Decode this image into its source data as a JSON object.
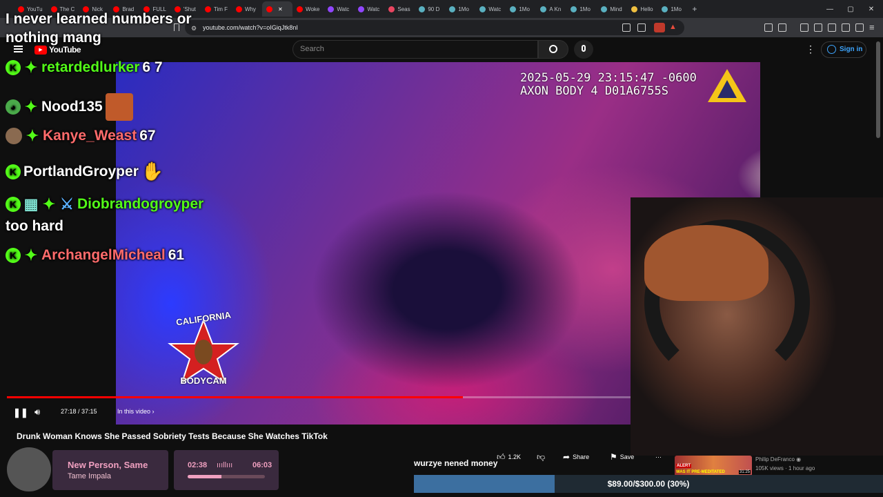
{
  "browser": {
    "tabs": [
      {
        "label": "YouTu",
        "color": "#ff0000"
      },
      {
        "label": "The C",
        "color": "#ff0000"
      },
      {
        "label": "Nick",
        "color": "#ff0000"
      },
      {
        "label": "Brad",
        "color": "#ff0000"
      },
      {
        "label": "FULL",
        "color": "#ff0000"
      },
      {
        "label": "'Shut",
        "color": "#ff0000"
      },
      {
        "label": "Tim F",
        "color": "#ff0000"
      },
      {
        "label": "Why",
        "color": "#ff0000"
      },
      {
        "label": "",
        "color": "#ff0000",
        "active": true
      },
      {
        "label": "Woke",
        "color": "#ff0000"
      },
      {
        "label": "Watc",
        "color": "#9146ff"
      },
      {
        "label": "Watc",
        "color": "#9146ff"
      },
      {
        "label": "Seas",
        "color": "#e94560"
      },
      {
        "label": "90 D",
        "color": "#5ab0c0"
      },
      {
        "label": "1Mo",
        "color": "#5ab0c0"
      },
      {
        "label": "Watc",
        "color": "#5ab0c0"
      },
      {
        "label": "1Mo",
        "color": "#5ab0c0"
      },
      {
        "label": "A Kn",
        "color": "#5ab0c0"
      },
      {
        "label": "1Mo",
        "color": "#5ab0c0"
      },
      {
        "label": "Mind",
        "color": "#5ab0c0"
      },
      {
        "label": "Hello",
        "color": "#f0c040"
      },
      {
        "label": "1Mo",
        "color": "#5ab0c0"
      }
    ],
    "new_tab": "+",
    "url": "youtube.com/watch?v=oIGiqJtk8nI"
  },
  "youtube": {
    "logo": "YouTube",
    "search_placeholder": "Search",
    "signin": "Sign in",
    "video_timestamp_line1": "2025-05-29 23:15:47 -0600",
    "video_timestamp_line2": "AXON BODY 4 D01A6755S",
    "logo_top": "CALIFORNIA",
    "logo_bottom": "BODYCAM",
    "progress": 0.731,
    "time": "27:18 / 37:15",
    "in_this_video": "In this video",
    "title": "Drunk Woman Knows She Passed Sobriety Tests Because She Watches TikTok",
    "likes": "1.2K",
    "share": "Share",
    "save": "Save",
    "related_channel": "Philip DeFranco",
    "related_meta": "105K views · 1 hour ago",
    "related_thumb_text": "WAS IT PRE-MEDITATED",
    "related_thumb_alert": "ALERT",
    "related_duration": "31:25"
  },
  "overlay": {
    "top_message": "I never learned numbers or nothing mang",
    "chat": [
      {
        "user": "retardedlurker",
        "text": "6 7",
        "color": "#53fc18"
      },
      {
        "user": "Nood135",
        "text": "",
        "color": "#ffffff"
      },
      {
        "user": "Kanye_Weast",
        "text": "67",
        "color": "#ff6b6b"
      },
      {
        "user": "PortlandGroyper",
        "text": "",
        "color": "#ffffff"
      },
      {
        "user": "Diobrandogroyper",
        "text": "",
        "color": "#53fc18"
      },
      {
        "user": "",
        "text": "too hard",
        "color": "#ffffff"
      },
      {
        "user": "ArchangelMicheal",
        "text": "61",
        "color": "#ff6b6b"
      }
    ],
    "now_playing_title": "New Person, Same",
    "now_playing_artist": "Tame Impala",
    "now_playing_elapsed": "02:38",
    "now_playing_total": "06:03",
    "now_playing_progress": 0.436,
    "caption": "wurzye nened money",
    "goal_text": "$89.00/$300.00 (30%)",
    "goal_progress": 0.3
  }
}
